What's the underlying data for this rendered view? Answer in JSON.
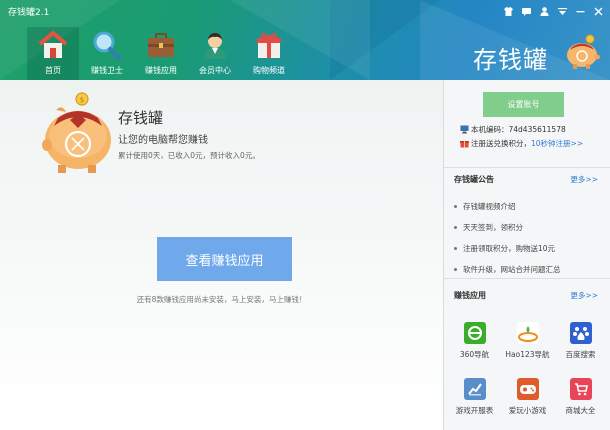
{
  "window": {
    "title": "存钱罐2.1",
    "controls": [
      {
        "name": "skin-icon"
      },
      {
        "name": "message-icon"
      },
      {
        "name": "user-icon"
      },
      {
        "name": "menu-icon"
      },
      {
        "name": "minimize-icon"
      },
      {
        "name": "close-icon"
      }
    ]
  },
  "nav": {
    "items": [
      {
        "label": "首页",
        "icon": "home-icon",
        "active": true
      },
      {
        "label": "赚钱卫士",
        "icon": "magnifier-icon",
        "active": false
      },
      {
        "label": "赚钱应用",
        "icon": "briefcase-icon",
        "active": false
      },
      {
        "label": "会员中心",
        "icon": "member-icon",
        "active": false
      },
      {
        "label": "购物频道",
        "icon": "gift-icon",
        "active": false
      }
    ]
  },
  "brand": {
    "title": "存钱罐",
    "logo": "piggy-bank-logo"
  },
  "main": {
    "title": "存钱罐",
    "subtitle": "让您的电脑帮您赚钱",
    "stats": "累计使用0天，已收入0元，预计收入0元。",
    "button_label": "查看赚钱应用",
    "hint": "还有8款赚钱应用尚未安装，马上安装，马上赚钱！"
  },
  "sidebar": {
    "setup_button": "设置账号",
    "machine_code": "本机编码：74d435611578",
    "register_prefix": "注册送兑换积分，",
    "register_link": "10秒钟注册>>",
    "notices_title": "存钱罐公告",
    "more_label": "更多>>",
    "notices": [
      "存钱罐视频介绍",
      "天天签到，领积分",
      "注册领取积分，购物送10元",
      "软件升级，网站合并问题汇总"
    ],
    "apps_title": "赚钱应用",
    "apps_more_label": "更多>>",
    "apps": [
      {
        "label": "360导航",
        "icon": "360-nav-icon",
        "color": "#3aae2a"
      },
      {
        "label": "Hao123导航",
        "icon": "hao123-icon",
        "color": "#ffffff"
      },
      {
        "label": "百度搜索",
        "icon": "baidu-icon",
        "color": "#2f5fd0"
      },
      {
        "label": "游戏开服表",
        "icon": "game-server-icon",
        "color": "#5a8ec9"
      },
      {
        "label": "爱玩小游戏",
        "icon": "mini-game-icon",
        "color": "#e05a2b"
      },
      {
        "label": "商城大全",
        "icon": "mall-icon",
        "color": "#e8445a"
      }
    ]
  },
  "colors": {
    "header_green": "#1fa06a",
    "header_blue": "#2386c4",
    "primary_button": "#6fa9ec",
    "setup_button": "#80cd8c",
    "link": "#2f7bd4"
  }
}
